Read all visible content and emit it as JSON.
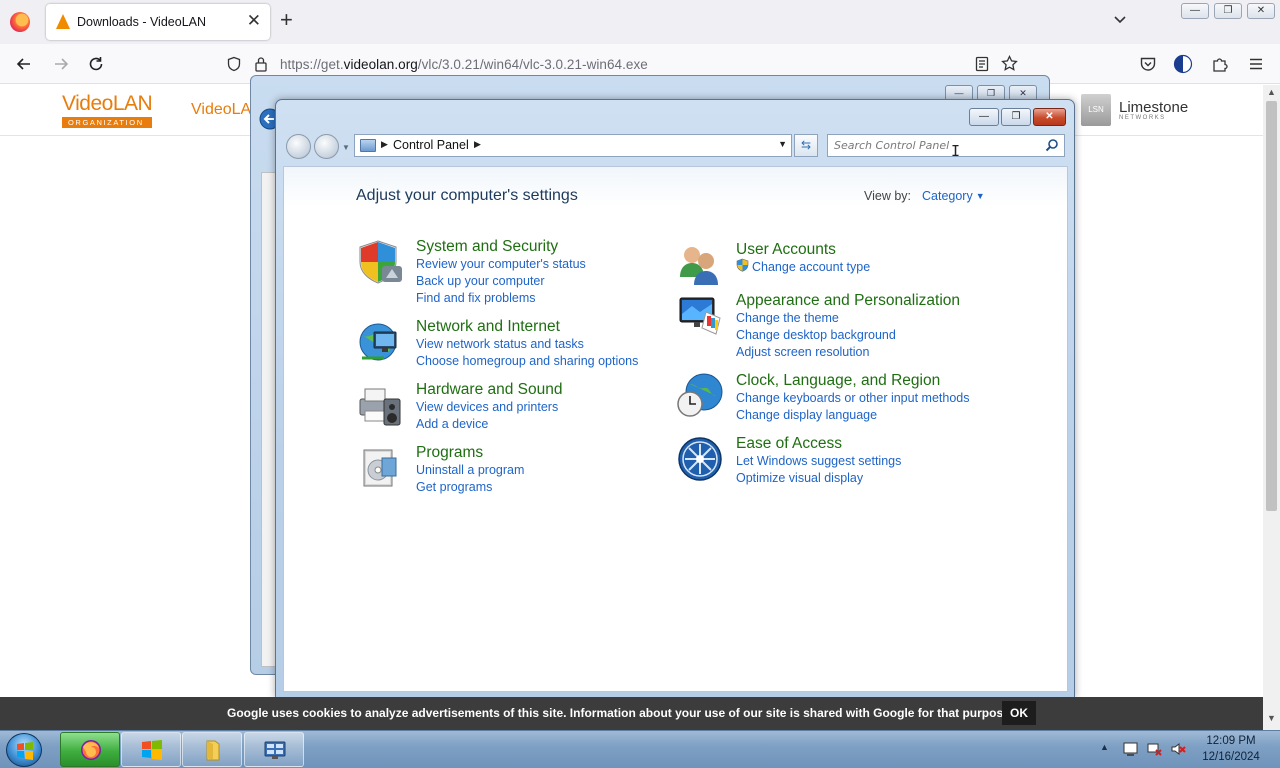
{
  "browser": {
    "tab_title": "Downloads - VideoLAN",
    "tab_close": "✕",
    "new_tab": "+",
    "url_prefix": "https://get.",
    "url_host": "videolan.org",
    "url_path": "/vlc/3.0.21/win64/vlc-3.0.21-win64.exe",
    "window_minimize": "—",
    "window_restore": "❐",
    "window_close": "✕"
  },
  "page": {
    "logo_text": "VideoLAN",
    "logo_sub": "ORGANIZATION",
    "nav_partial": "VideoLA",
    "sponsor_box": "LSN",
    "sponsor_name": "Limestone",
    "sponsor_sub": "NETWORKS",
    "cookie_text": "Google uses cookies to analyze advertisements of this site. Information about your use of our site is shared with Google for that purpose.",
    "cookie_ok": "OK"
  },
  "control_panel": {
    "breadcrumb": "Control Panel",
    "search_placeholder": "Search Control Panel",
    "heading": "Adjust your computer's settings",
    "view_by_label": "View by:",
    "view_by_value": "Category",
    "caption_min": "—",
    "caption_max": "❐",
    "caption_close": "✕",
    "categories_left": [
      {
        "title": "System and Security",
        "links": [
          "Review your computer's status",
          "Back up your computer",
          "Find and fix problems"
        ],
        "icon": "shield-icon"
      },
      {
        "title": "Network and Internet",
        "links": [
          "View network status and tasks",
          "Choose homegroup and sharing options"
        ],
        "icon": "network-globe-icon"
      },
      {
        "title": "Hardware and Sound",
        "links": [
          "View devices and printers",
          "Add a device"
        ],
        "icon": "printer-speaker-icon"
      },
      {
        "title": "Programs",
        "links": [
          "Uninstall a program",
          "Get programs"
        ],
        "icon": "programs-box-icon"
      }
    ],
    "categories_right": [
      {
        "title": "User Accounts",
        "links": [
          "Change account type"
        ],
        "icon": "users-icon"
      },
      {
        "title": "Appearance and Personalization",
        "links": [
          "Change the theme",
          "Change desktop background",
          "Adjust screen resolution"
        ],
        "icon": "monitor-palette-icon"
      },
      {
        "title": "Clock, Language, and Region",
        "links": [
          "Change keyboards or other input methods",
          "Change display language"
        ],
        "icon": "clock-globe-icon"
      },
      {
        "title": "Ease of Access",
        "links": [
          "Let Windows suggest settings",
          "Optimize visual display"
        ],
        "icon": "ease-of-access-icon"
      }
    ]
  },
  "taskbar": {
    "time": "12:09 PM",
    "date": "12/16/2024",
    "tray_up": "▲"
  }
}
